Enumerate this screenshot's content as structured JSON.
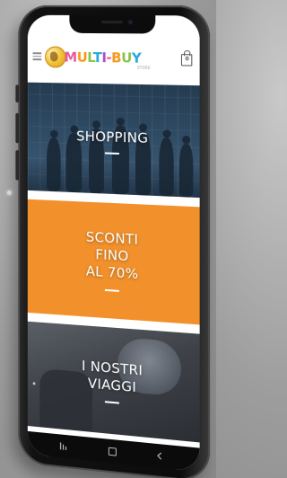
{
  "app": {
    "logo": {
      "brand": "MULTI-BUY",
      "tagline": "STORE"
    },
    "cart": {
      "count": "0"
    }
  },
  "banners": [
    {
      "title": "SHOPPING"
    },
    {
      "title_lines": [
        "SCONTI",
        "FINO",
        "AL 70%"
      ]
    },
    {
      "title_lines": [
        "I NOSTRI",
        "VIAGGI"
      ]
    }
  ],
  "colors": {
    "accent_orange": "#f2912b",
    "phone_body": "#0c0c0c",
    "background": "#9d9d9d"
  },
  "icons": {
    "menu": "hamburger-icon",
    "cart": "shopping-bag-icon",
    "nav_recent": "recent-apps-icon",
    "nav_home": "home-icon",
    "nav_back": "back-icon"
  }
}
